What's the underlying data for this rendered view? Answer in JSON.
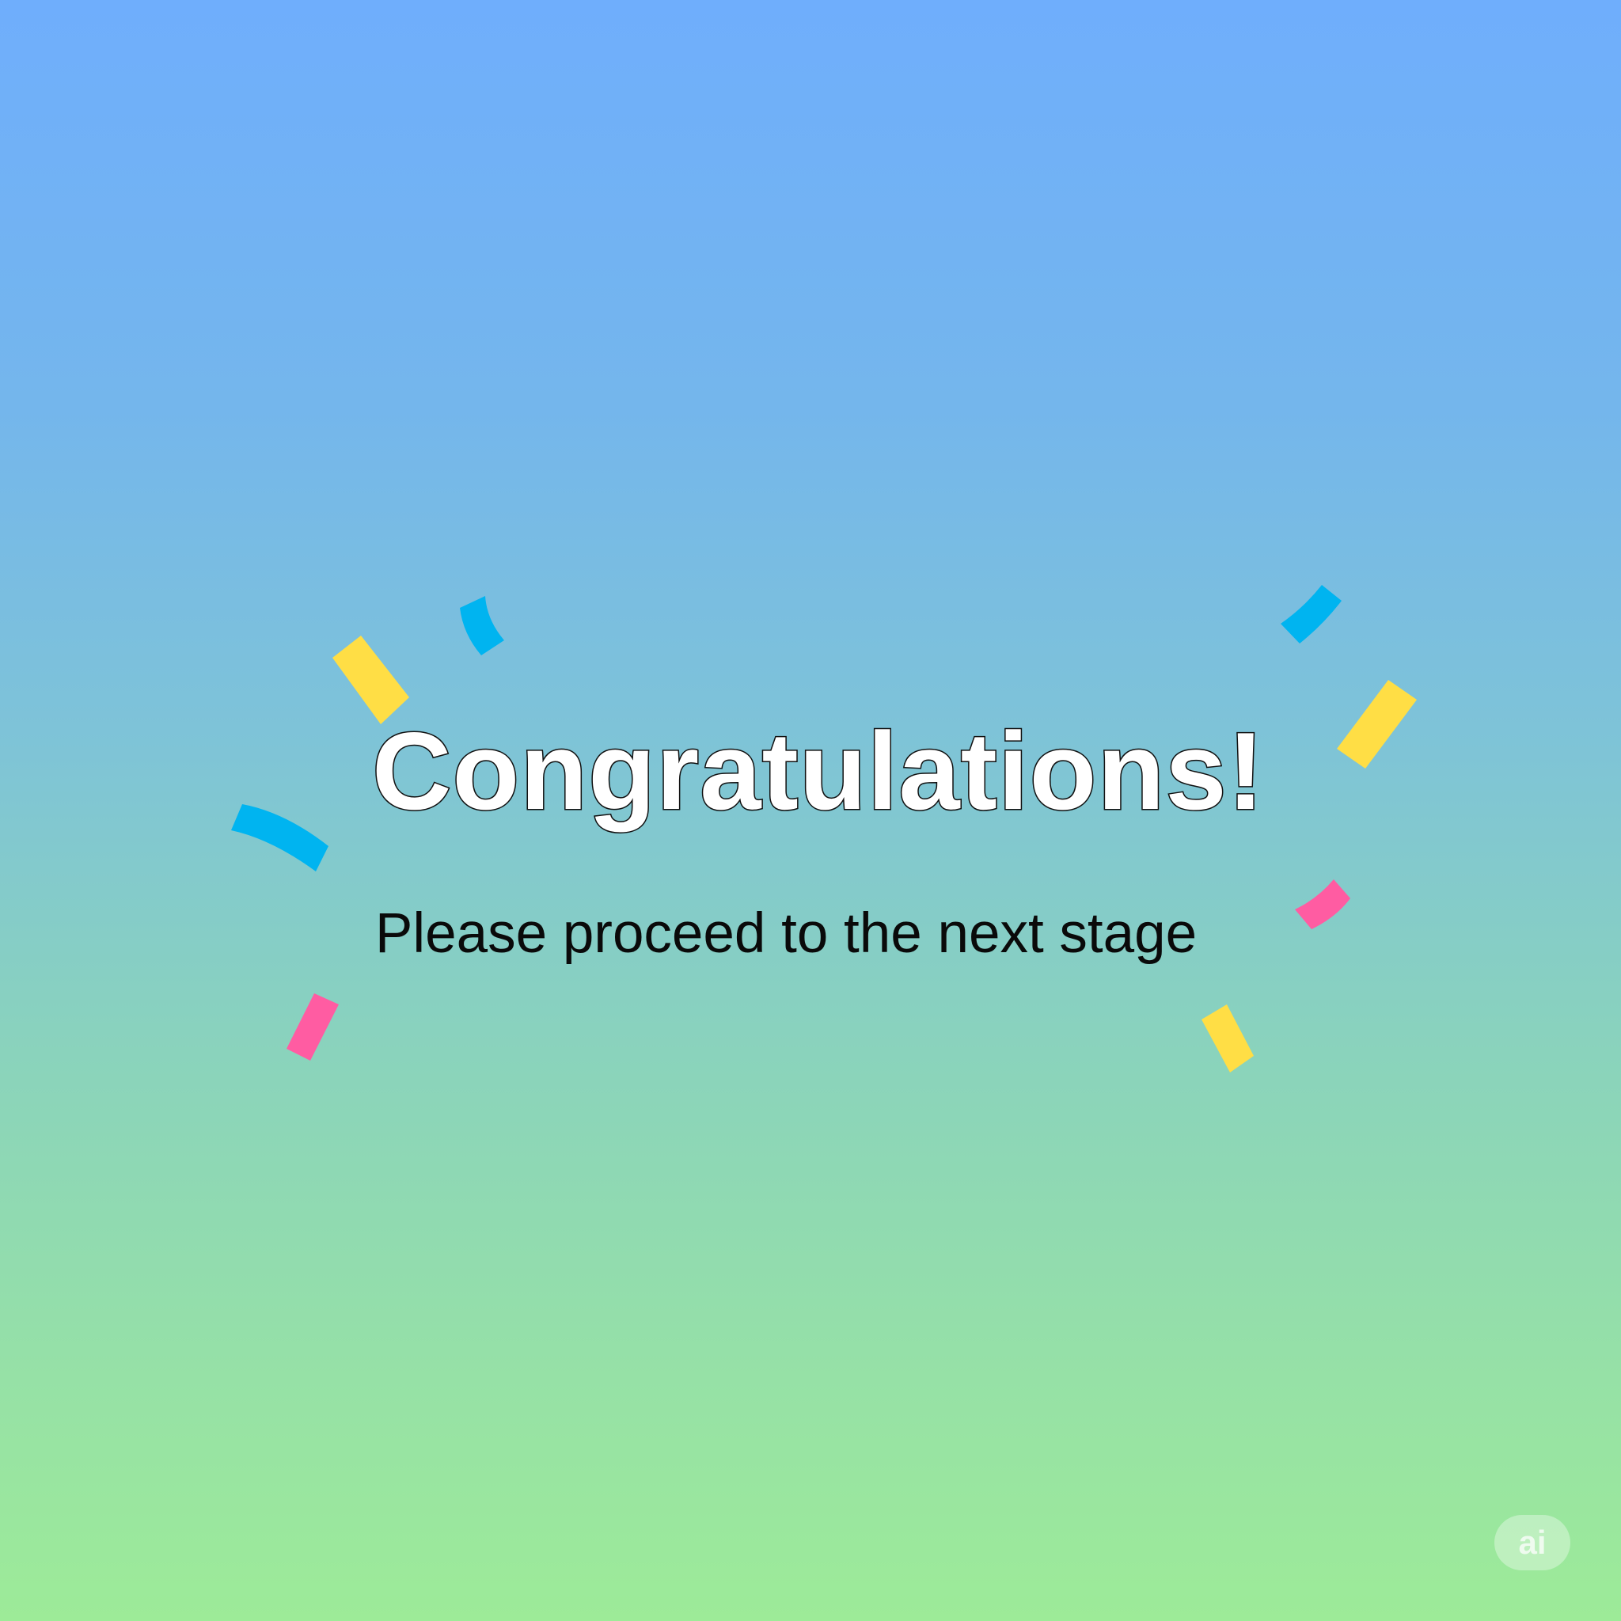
{
  "screen": {
    "title": "Congratulations!",
    "subtitle": "Please proceed to the next stage"
  },
  "watermark": {
    "text": "ai"
  },
  "colors": {
    "confetti_yellow": "#ffde45",
    "confetti_blue": "#00b4f0",
    "confetti_pink": "#ff5ca2",
    "title_fill": "#ffffff",
    "title_outline": "#111111",
    "subtitle": "#0a0a0a"
  }
}
